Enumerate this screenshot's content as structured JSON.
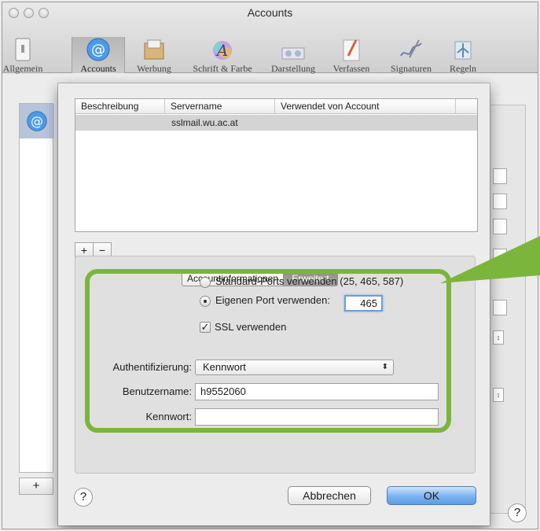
{
  "window": {
    "title": "Accounts"
  },
  "toolbar": {
    "items": [
      {
        "label": "Allgemein",
        "icon": "switch-icon"
      },
      {
        "label": "Accounts",
        "icon": "at-icon",
        "selected": true
      },
      {
        "label": "Werbung",
        "icon": "junk-mail-icon"
      },
      {
        "label": "Schrift & Farbe",
        "icon": "font-color-icon"
      },
      {
        "label": "Darstellung",
        "icon": "glasses-icon"
      },
      {
        "label": "Verfassen",
        "icon": "compose-icon"
      },
      {
        "label": "Signaturen",
        "icon": "signature-icon"
      },
      {
        "label": "Regeln",
        "icon": "rules-icon"
      }
    ]
  },
  "server_table": {
    "columns": [
      "Beschreibung",
      "Servername",
      "Verwendet von Account"
    ],
    "rows": [
      {
        "description": "",
        "servername": "sslmail.wu.ac.at",
        "used_by": ""
      }
    ],
    "add_label": "+",
    "remove_label": "−"
  },
  "tabs": {
    "account_info": "Accountinformationen",
    "advanced": "Erweitert"
  },
  "advanced": {
    "standard_ports_label": "Standard-Ports verwenden (25, 465, 587)",
    "custom_port_label": "Eigenen Port verwenden:",
    "port_value": "465",
    "ssl_label": "SSL verwenden",
    "auth_label": "Authentifizierung:",
    "auth_value": "Kennwort",
    "username_label": "Benutzername:",
    "username_value": "h9552060",
    "password_label": "Kennwort:",
    "password_value": ""
  },
  "buttons": {
    "cancel": "Abbrechen",
    "ok": "OK",
    "help": "?",
    "add": "+"
  },
  "colors": {
    "highlight": "#7cb53b",
    "ok_button": "#6aa6ea"
  }
}
